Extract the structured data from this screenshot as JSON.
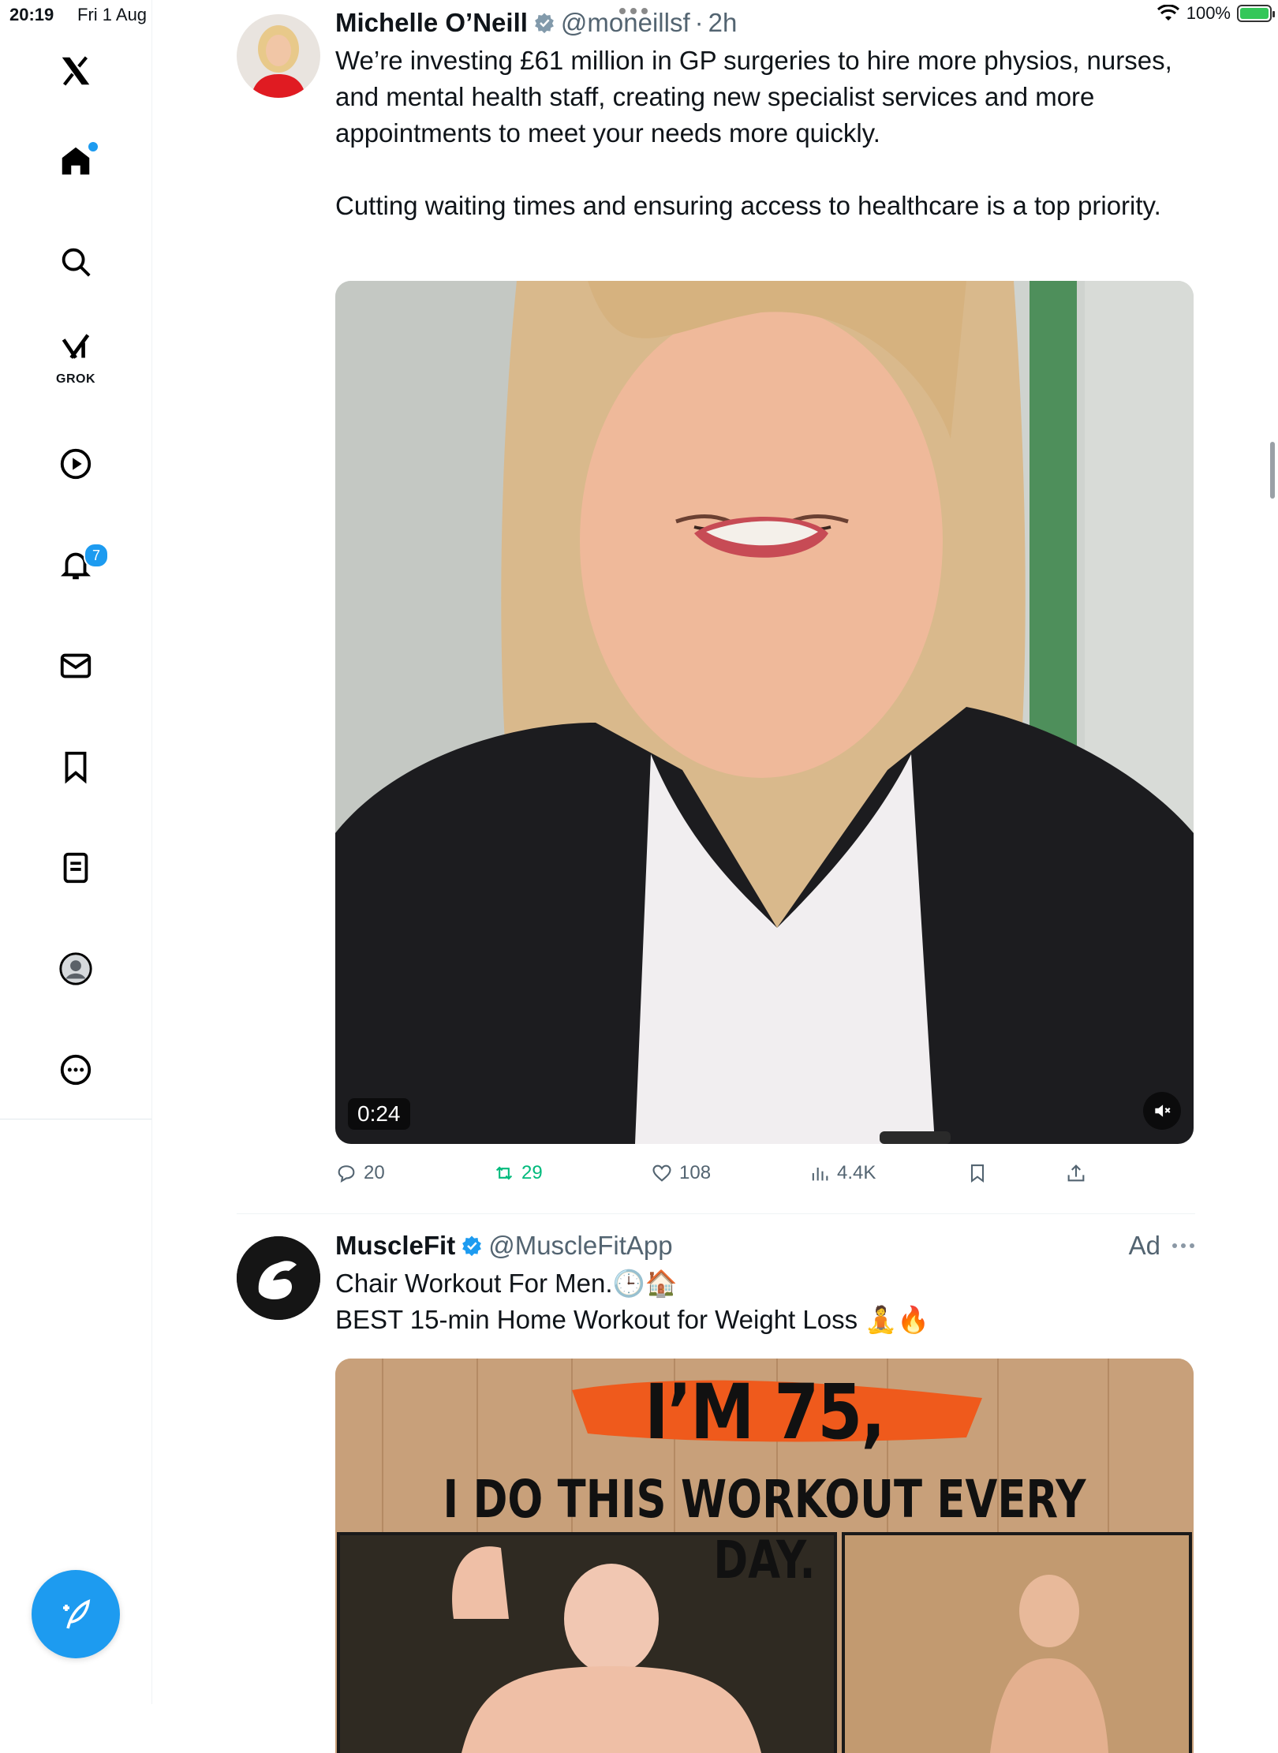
{
  "status": {
    "time": "20:19",
    "date": "Fri 1 Aug",
    "battery": "100%"
  },
  "sidebar": {
    "items": [
      {
        "name": "logo"
      },
      {
        "name": "home"
      },
      {
        "name": "explore"
      },
      {
        "name": "grok",
        "label": "GROK"
      },
      {
        "name": "videos"
      },
      {
        "name": "notifications",
        "badge": "7"
      },
      {
        "name": "messages"
      },
      {
        "name": "bookmarks"
      },
      {
        "name": "lists"
      },
      {
        "name": "profile"
      },
      {
        "name": "more"
      }
    ]
  },
  "tweet1": {
    "name": "Michelle O’Neill",
    "handle": "@moneillsf",
    "sep": "·",
    "time": "2h",
    "paragraphs": [
      "We’re investing £61 million in GP surgeries to hire more physios, nurses, and mental health staff, creating new specialist services and more appointments to meet your needs more quickly.",
      "Cutting waiting times and ensuring access to healthcare is a top priority."
    ],
    "video": {
      "duration": "0:24"
    },
    "stats": {
      "replies": "20",
      "reposts": "29",
      "likes": "108",
      "views": "4.4K"
    }
  },
  "tweet2": {
    "name": "MuscleFit",
    "handle": "@MuscleFitApp",
    "ad_label": "Ad",
    "line1": "Chair Workout For Men.🕒🏠",
    "line2": "BEST 15-min Home Workout for Weight Loss 🧘🔥",
    "image": {
      "headline1": "I’M 75,",
      "headline2": "I DO THIS WORKOUT EVERY DAY."
    }
  },
  "colors": {
    "accent": "#1d9bf0",
    "repost_active": "#00ba7c",
    "secondary_text": "#536471"
  }
}
